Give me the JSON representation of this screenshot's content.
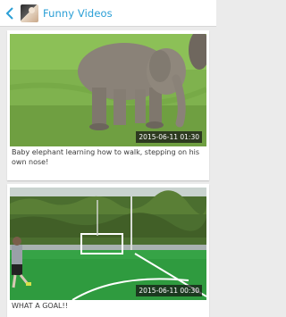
{
  "app_bar": {
    "title": "Funny Videos",
    "back_icon": "chevron-left-icon",
    "accent_color": "#2a9fd6"
  },
  "videos": [
    {
      "timestamp": "2015-06-11 01:30",
      "caption": "Baby elephant learning how to walk, stepping on his own nose!"
    },
    {
      "timestamp": "2015-06-11 00:30",
      "caption": "WHAT A GOAL!!"
    }
  ]
}
